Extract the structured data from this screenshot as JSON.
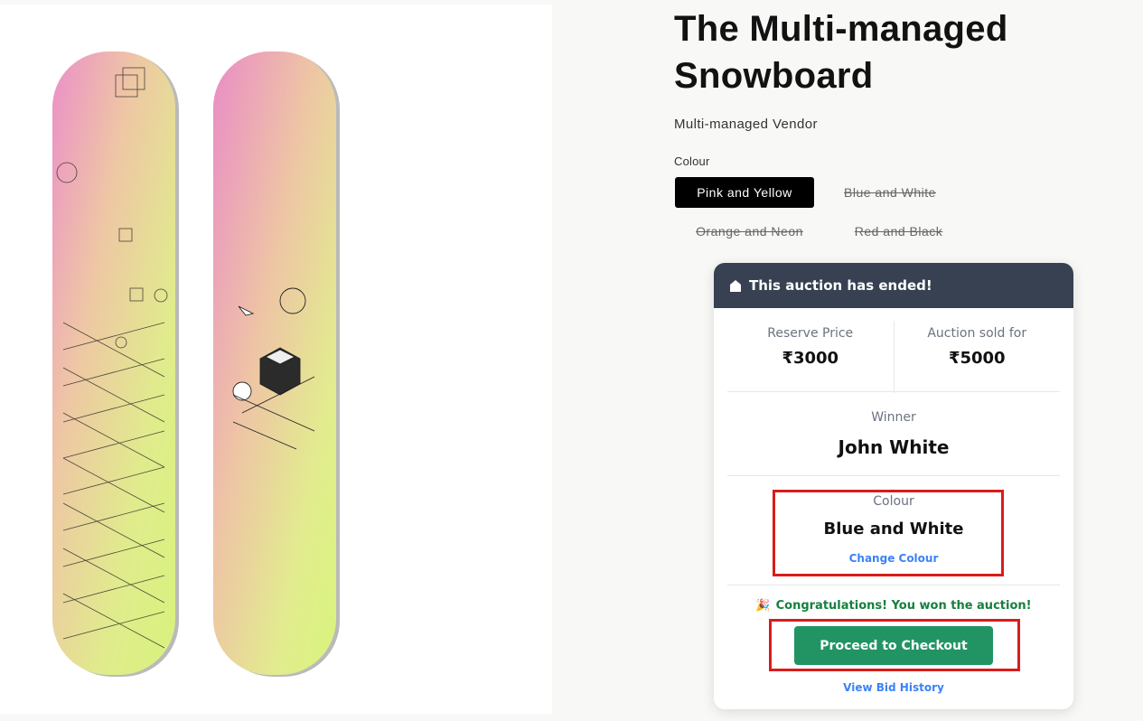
{
  "product": {
    "title": "The Multi-managed Snowboard",
    "vendor": "Multi-managed Vendor",
    "image_alt": "Snowboard product image"
  },
  "options": {
    "label": "Colour",
    "variants": [
      {
        "label": "Pink and Yellow",
        "selected": true,
        "available": true
      },
      {
        "label": "Blue and White",
        "selected": false,
        "available": false
      },
      {
        "label": "Orange and Neon",
        "selected": false,
        "available": false
      },
      {
        "label": "Red and Black",
        "selected": false,
        "available": false
      }
    ]
  },
  "auction": {
    "header": "This auction has ended!",
    "reserve_label": "Reserve Price",
    "reserve_value": "₹3000",
    "sold_label": "Auction sold for",
    "sold_value": "₹5000",
    "winner_label": "Winner",
    "winner_name": "John White",
    "colour_label": "Colour",
    "colour_value": "Blue and White",
    "change_colour": "Change Colour",
    "congrats": "Congratulations! You won the auction!",
    "checkout": "Proceed to Checkout",
    "bid_history": "View Bid History"
  },
  "colors": {
    "header_bg": "#374151",
    "checkout_bg": "#229464",
    "link": "#3b82f6",
    "highlight": "#d91c1c",
    "success_text": "#15803d"
  }
}
